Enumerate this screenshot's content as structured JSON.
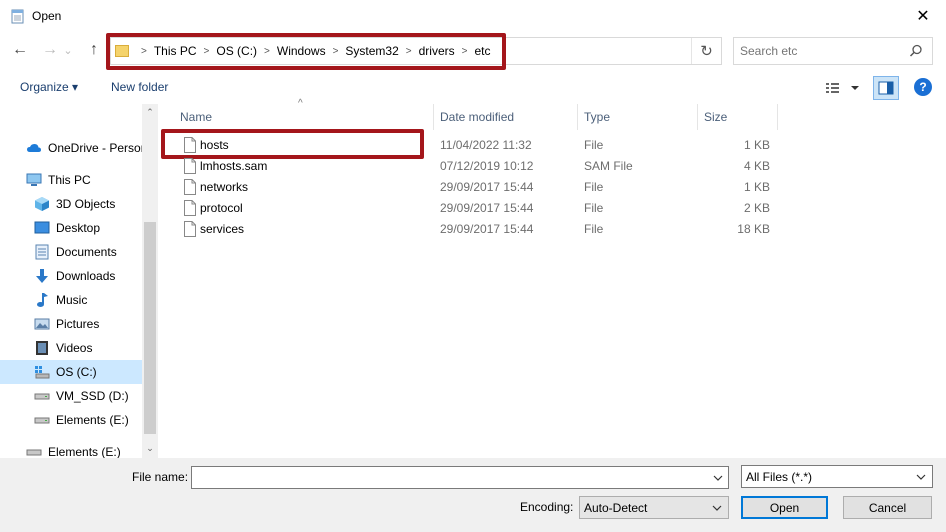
{
  "window": {
    "title": "Open",
    "close_glyph": "✕"
  },
  "navigation": {
    "back_glyph": "←",
    "forward_glyph": "→",
    "recent_glyph": "⌄",
    "up_glyph": "↑",
    "breadcrumbs": [
      "This PC",
      "OS (C:)",
      "Windows",
      "System32",
      "drivers",
      "etc"
    ],
    "separator": ">",
    "refresh_glyph": "↻",
    "search_placeholder": "Search etc"
  },
  "toolbar": {
    "organize_label": "Organize ▾",
    "new_folder_label": "New folder"
  },
  "sidebar": {
    "items": [
      {
        "label": "OneDrive - Personal",
        "icon": "cloud-icon"
      },
      {
        "label": "This PC",
        "icon": "computer-icon"
      },
      {
        "label": "3D Objects",
        "icon": "cube-icon"
      },
      {
        "label": "Desktop",
        "icon": "desktop-icon"
      },
      {
        "label": "Documents",
        "icon": "documents-icon"
      },
      {
        "label": "Downloads",
        "icon": "download-icon"
      },
      {
        "label": "Music",
        "icon": "music-icon"
      },
      {
        "label": "Pictures",
        "icon": "pictures-icon"
      },
      {
        "label": "Videos",
        "icon": "videos-icon"
      },
      {
        "label": "OS (C:)",
        "icon": "os-drive-icon"
      },
      {
        "label": "VM_SSD (D:)",
        "icon": "drive-icon"
      },
      {
        "label": "Elements (E:)",
        "icon": "drive-icon"
      },
      {
        "label": "Elements (E:)",
        "icon": "drive-icon"
      }
    ],
    "selected_index": 9
  },
  "columns": {
    "name": "Name",
    "date": "Date modified",
    "type": "Type",
    "size": "Size"
  },
  "files": [
    {
      "name": "hosts",
      "date": "11/04/2022 11:32",
      "type": "File",
      "size": "1 KB"
    },
    {
      "name": "lmhosts.sam",
      "date": "07/12/2019 10:12",
      "type": "SAM File",
      "size": "4 KB"
    },
    {
      "name": "networks",
      "date": "29/09/2017 15:44",
      "type": "File",
      "size": "1 KB"
    },
    {
      "name": "protocol",
      "date": "29/09/2017 15:44",
      "type": "File",
      "size": "2 KB"
    },
    {
      "name": "services",
      "date": "29/09/2017 15:44",
      "type": "File",
      "size": "18 KB"
    }
  ],
  "bottom": {
    "filename_label": "File name:",
    "filename_value": "",
    "filter_value": "All Files  (*.*)",
    "encoding_label": "Encoding:",
    "encoding_value": "Auto-Detect",
    "open_label": "Open",
    "cancel_label": "Cancel"
  },
  "colors": {
    "highlight": "#a4161b",
    "selection": "#cce8ff",
    "link": "#1a3e6e"
  }
}
